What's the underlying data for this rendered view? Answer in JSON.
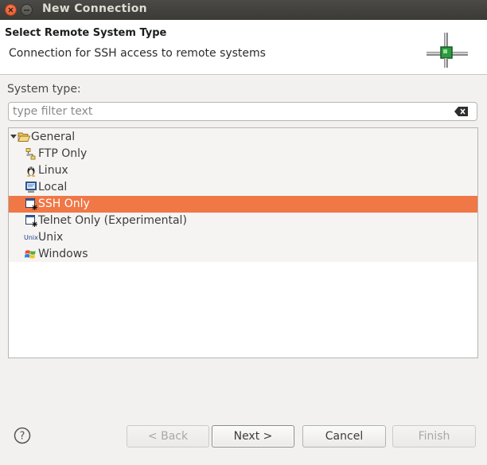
{
  "window": {
    "title": "New Connection"
  },
  "banner": {
    "title": "Select Remote System Type",
    "description": "Connection for SSH access to remote systems",
    "icon": "network-connection-icon"
  },
  "system_type": {
    "label": "System type:",
    "filter_placeholder": "type filter text",
    "filter_value": ""
  },
  "tree": {
    "group": {
      "label": "General",
      "expanded": true,
      "icon": "folder-open-icon"
    },
    "items": [
      {
        "label": "FTP Only",
        "icon": "ftp-icon",
        "selected": false
      },
      {
        "label": "Linux",
        "icon": "linux-penguin-icon",
        "selected": false
      },
      {
        "label": "Local",
        "icon": "local-computer-icon",
        "selected": false
      },
      {
        "label": "SSH Only",
        "icon": "ssh-terminal-icon",
        "selected": true
      },
      {
        "label": "Telnet Only (Experimental)",
        "icon": "telnet-terminal-icon",
        "selected": false
      },
      {
        "label": "Unix",
        "icon": "unix-icon",
        "icon_text": "Unix",
        "selected": false
      },
      {
        "label": "Windows",
        "icon": "windows-flag-icon",
        "selected": false
      }
    ]
  },
  "buttons": {
    "help": "?",
    "back": "< Back",
    "next": "Next >",
    "cancel": "Cancel",
    "finish": "Finish"
  },
  "colors": {
    "selection": "#f07746",
    "titlebar": "#3b3a36",
    "close_button": "#e2532a"
  }
}
